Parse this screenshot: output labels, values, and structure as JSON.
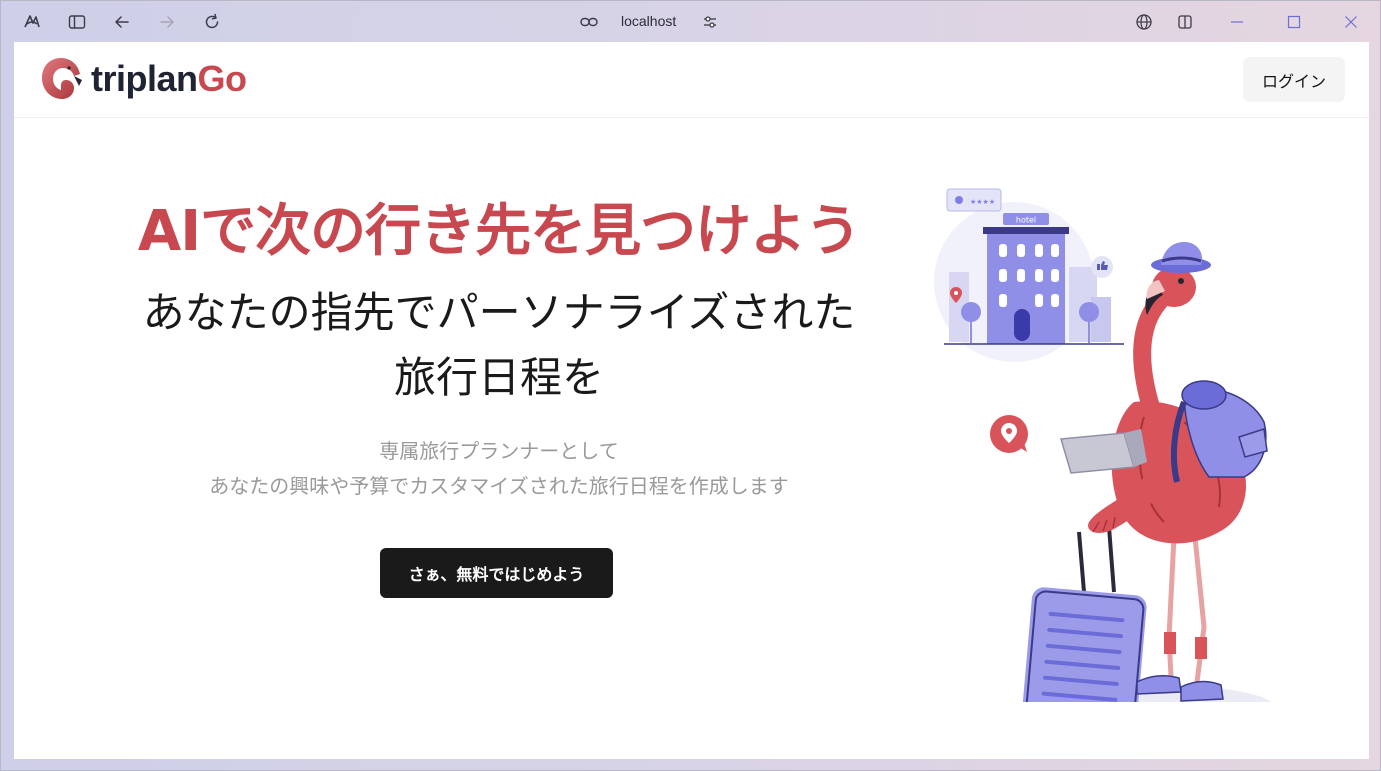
{
  "browser": {
    "url": "localhost",
    "icons": {
      "app": "app-logo-icon",
      "sidebar": "sidebar-toggle-icon",
      "back": "back-arrow-icon",
      "forward": "forward-arrow-icon",
      "reload": "reload-icon",
      "link": "link-icon",
      "site_settings": "site-settings-icon",
      "language": "globe-icon",
      "split": "split-view-icon",
      "minimize": "minimize-icon",
      "maximize": "maximize-icon",
      "close": "close-icon"
    }
  },
  "header": {
    "logo_text_main": "triplan",
    "logo_text_accent": "Go",
    "login_label": "ログイン"
  },
  "hero": {
    "headline": "AIで次の行き先を見つけよう",
    "subtitle_line1": "あなたの指先でパーソナライズされた",
    "subtitle_line2": "旅行日程を",
    "desc_line1": "専属旅行プランナーとして",
    "desc_line2": "あなたの興味や予算でカスタマイズされた旅行日程を作成します",
    "cta_label": "さぁ、無料ではじめよう"
  },
  "illustration": {
    "hotel_sign": "hotel",
    "rating_stars": "★★★★"
  },
  "colors": {
    "brand_red": "#c8484f",
    "dark": "#1a1a1a",
    "muted": "#9a9a9a",
    "illustration_purple": "#7e7ee6"
  }
}
